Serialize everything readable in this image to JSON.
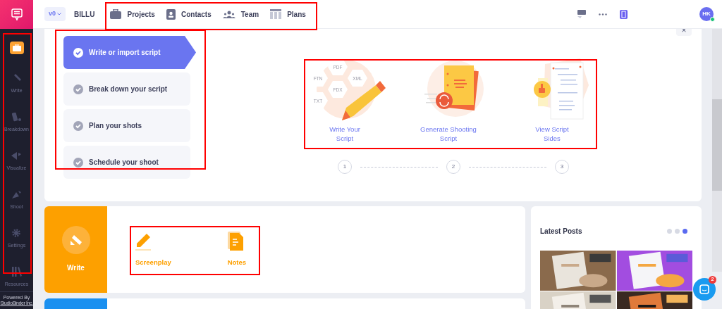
{
  "topbar": {
    "version": "v0",
    "project": "BILLU",
    "nav": [
      {
        "label": "Projects"
      },
      {
        "label": "Contacts"
      },
      {
        "label": "Team"
      },
      {
        "label": "Plans"
      }
    ],
    "avatar": "HK"
  },
  "sidebar": {
    "items": [
      {
        "selected": true
      },
      {
        "label": "Write",
        "selected": false
      },
      {
        "label": "Breakdown",
        "selected": false
      },
      {
        "label": "Visualize",
        "selected": false
      },
      {
        "label": "Shoot",
        "selected": false
      },
      {
        "label": "Settings",
        "selected": false
      },
      {
        "label": "Resources",
        "selected": false
      }
    ],
    "footer": [
      "Powered By",
      "StudioBinder Inc."
    ]
  },
  "onboarding": {
    "close": "×",
    "steps": [
      {
        "label": "Write or import script",
        "selected": true
      },
      {
        "label": "Break down your script",
        "selected": false
      },
      {
        "label": "Plan your shots",
        "selected": false
      },
      {
        "label": "Schedule your shoot",
        "selected": false
      }
    ],
    "cards": [
      {
        "title": "Write Your Script",
        "badges": [
          "PDF",
          "FTN",
          "XML",
          "FDX",
          "TXT"
        ]
      },
      {
        "title": "Generate Shooting Script"
      },
      {
        "title": "View Script Sides"
      }
    ],
    "progress": [
      "1",
      "2",
      "3"
    ]
  },
  "write_panel": {
    "label": "Write",
    "tools": [
      {
        "label": "Screenplay"
      },
      {
        "label": "Notes"
      }
    ]
  },
  "latest_posts": {
    "title": "Latest Posts",
    "dots": [
      {
        "selected": false
      },
      {
        "selected": false
      },
      {
        "selected": true
      }
    ]
  },
  "chat": {
    "badge": "2"
  }
}
